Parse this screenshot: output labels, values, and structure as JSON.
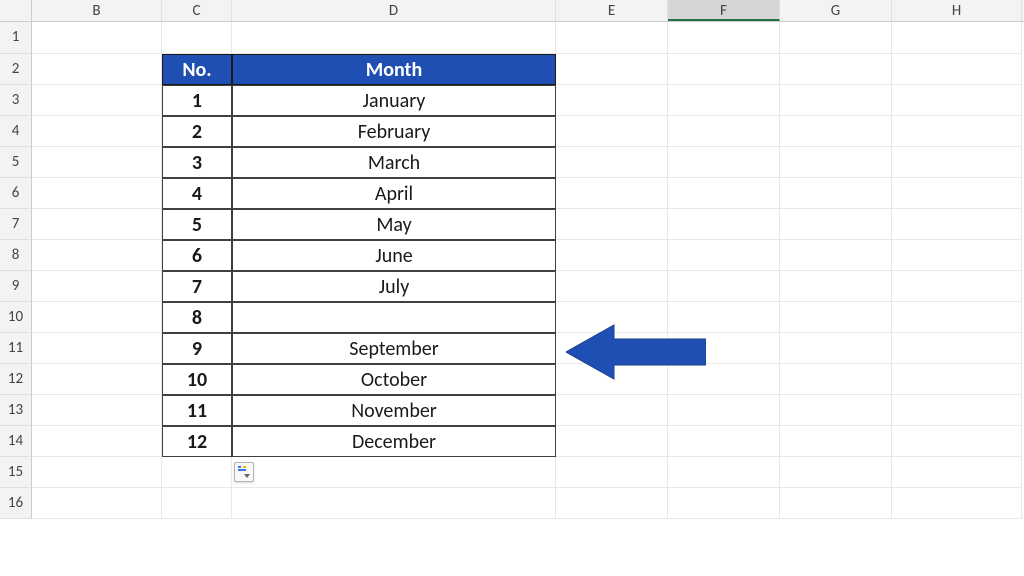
{
  "columns": {
    "B": "B",
    "C": "C",
    "D": "D",
    "E": "E",
    "F": "F",
    "G": "G",
    "H": "H"
  },
  "selected_column": "F",
  "row_labels": [
    "1",
    "2",
    "3",
    "4",
    "5",
    "6",
    "7",
    "8",
    "9",
    "10",
    "11",
    "12",
    "13",
    "14",
    "15",
    "16"
  ],
  "table": {
    "headers": {
      "no": "No.",
      "month": "Month"
    },
    "rows": [
      {
        "no": "1",
        "month": "January"
      },
      {
        "no": "2",
        "month": "February"
      },
      {
        "no": "3",
        "month": "March"
      },
      {
        "no": "4",
        "month": "April"
      },
      {
        "no": "5",
        "month": "May"
      },
      {
        "no": "6",
        "month": "June"
      },
      {
        "no": "7",
        "month": "July"
      },
      {
        "no": "8",
        "month": ""
      },
      {
        "no": "9",
        "month": "September"
      },
      {
        "no": "10",
        "month": "October"
      },
      {
        "no": "11",
        "month": "November"
      },
      {
        "no": "12",
        "month": "December"
      }
    ]
  },
  "colors": {
    "header_bg": "#1F4FB3",
    "arrow_fill": "#1F4FB3"
  },
  "annotation": {
    "arrow_target_row": 10
  }
}
